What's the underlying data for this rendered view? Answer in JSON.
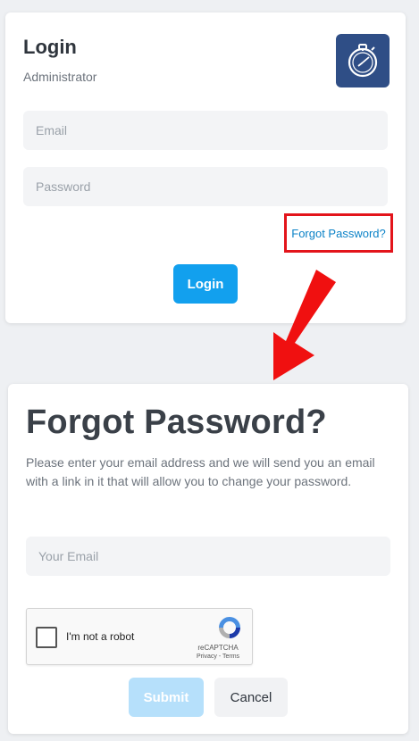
{
  "login": {
    "title": "Login",
    "subtitle": "Administrator",
    "email_placeholder": "Email",
    "password_placeholder": "Password",
    "forgot_link": "Forgot Password?",
    "login_button": "Login",
    "logo_icon": "stopwatch-icon"
  },
  "annotation": {
    "highlight_color": "#e3141b",
    "arrow_color": "#f01010"
  },
  "forgot": {
    "title": "Forgot Password?",
    "description": "Please enter your email address and we will send you an email with a link in it that will allow you to change your password.",
    "email_placeholder": "Your Email",
    "recaptcha": {
      "label": "I'm not a robot",
      "brand": "reCAPTCHA",
      "links": "Privacy - Terms"
    },
    "submit_button": "Submit",
    "cancel_button": "Cancel"
  },
  "colors": {
    "primary": "#12a0ee",
    "primary_disabled": "#b6e0fb",
    "link": "#0b82c7",
    "logo_bg": "#2f4e86"
  }
}
